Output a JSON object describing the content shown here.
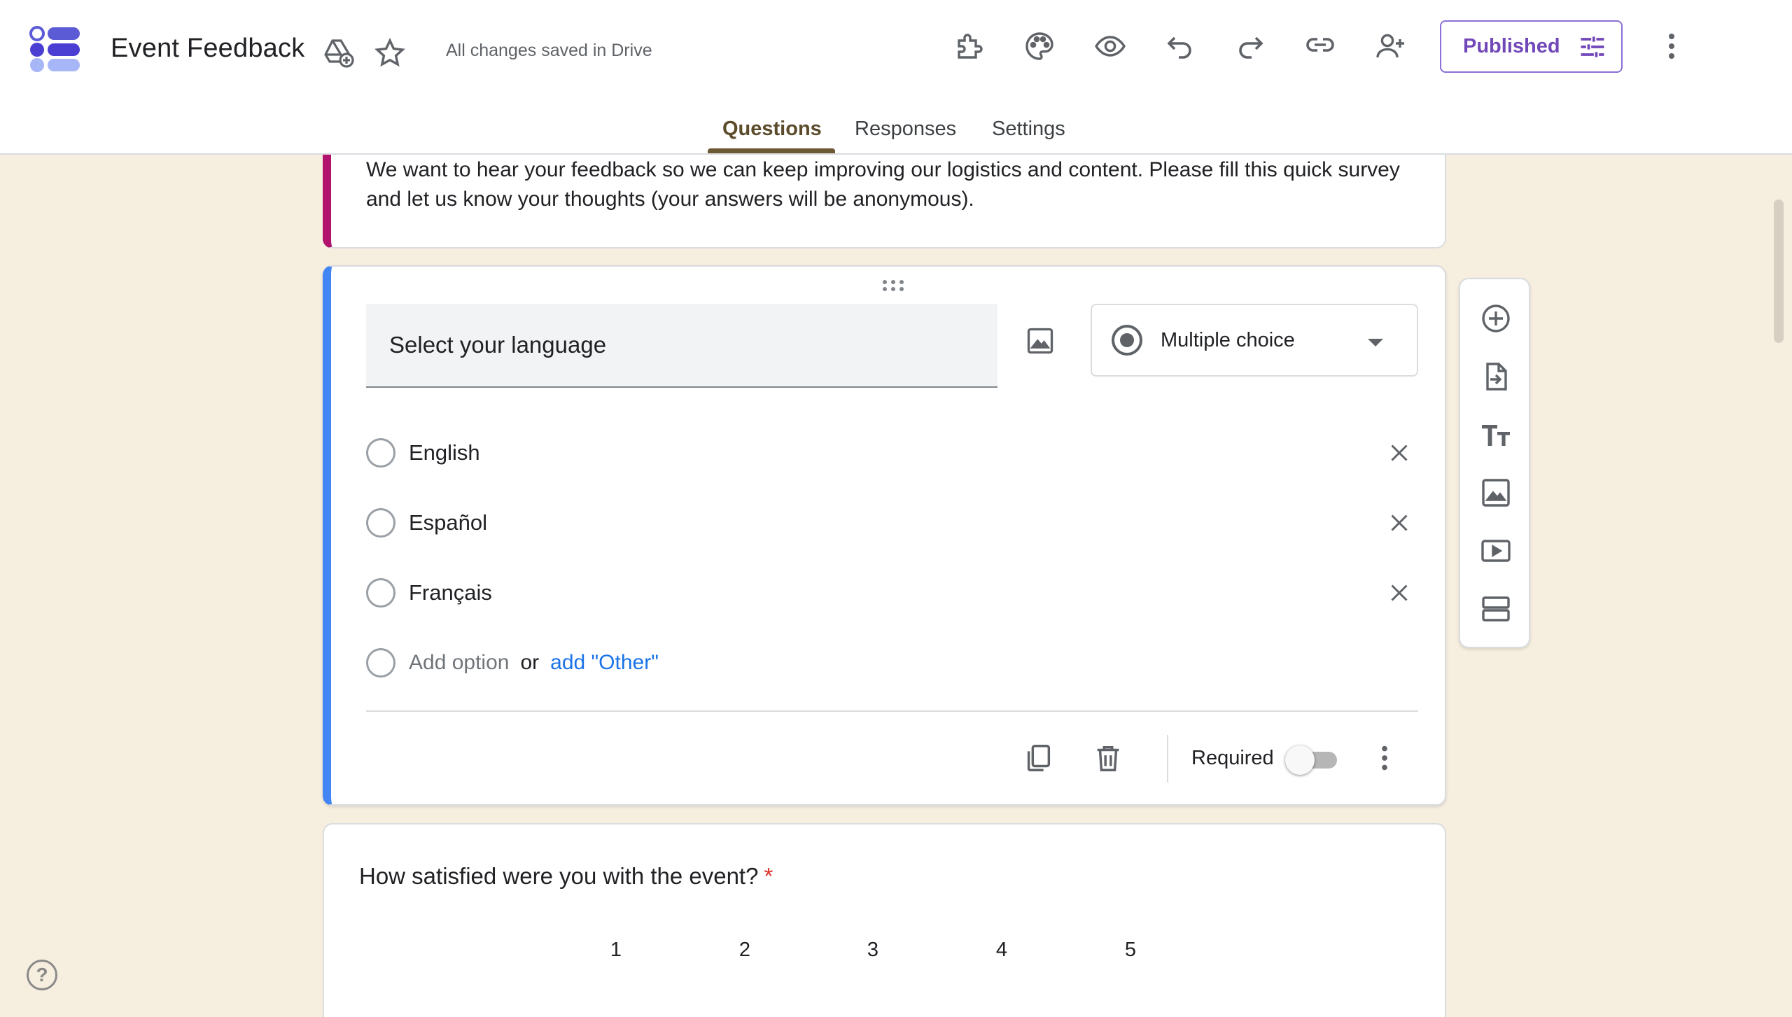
{
  "header": {
    "title": "Event Feedback",
    "save_status": "All changes saved in Drive",
    "publish_label": "Published",
    "icons": [
      "add-to-drive-icon",
      "star-icon",
      "addon-puzzle-icon",
      "palette-icon",
      "preview-eye-icon",
      "undo-icon",
      "redo-icon",
      "link-icon",
      "add-collaborator-icon",
      "more-vert-icon"
    ],
    "accent_color": "#7248b9"
  },
  "tabs": [
    {
      "label": "Questions",
      "active": true
    },
    {
      "label": "Responses",
      "active": false
    },
    {
      "label": "Settings",
      "active": false
    }
  ],
  "description": {
    "text": "We want to hear your feedback so we can keep improving our logistics and content. Please fill this quick survey and let us know your thoughts (your answers will be anonymous).",
    "accent_color": "#b0126e"
  },
  "question1": {
    "title": "Select your language",
    "type_label": "Multiple choice",
    "options": [
      "English",
      "Español",
      "Français"
    ],
    "add_option": "Add option",
    "or_text": "or",
    "add_other": "add \"Other\"",
    "required_label": "Required",
    "required": false,
    "accent_color": "#4285f4"
  },
  "question2": {
    "title": "How satisfied were you with the event?",
    "required_mark": "*",
    "scale": [
      "1",
      "2",
      "3",
      "4",
      "5"
    ]
  },
  "side_toolbar": [
    "add-question-icon",
    "import-questions-icon",
    "add-title-icon",
    "add-image-icon",
    "add-video-icon",
    "add-section-icon"
  ],
  "help": "?"
}
